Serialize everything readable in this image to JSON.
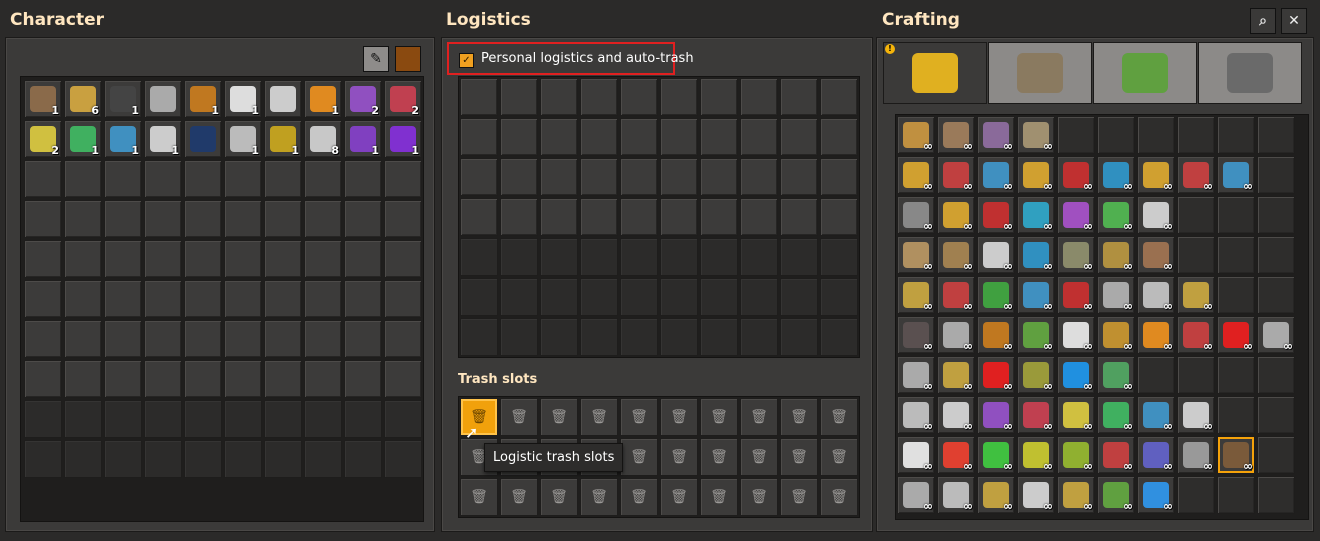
{
  "character": {
    "title": "Character",
    "main_inventory": [
      {
        "icon": "wooden-chest",
        "color": "#8a6a4a",
        "count": "1"
      },
      {
        "icon": "fast-splitter",
        "color": "#c9a040",
        "count": "6"
      },
      {
        "icon": "pistol",
        "color": "#444444",
        "count": "1"
      },
      {
        "icon": "submachine-gun",
        "color": "#aaaaaa",
        "count": ""
      },
      {
        "icon": "car",
        "color": "#c07820",
        "count": "1"
      },
      {
        "icon": "repair-pack",
        "color": "#dddddd",
        "count": "1"
      },
      {
        "icon": "car-white",
        "color": "#cccccc",
        "count": ""
      },
      {
        "icon": "spidertron",
        "color": "#e08a20",
        "count": "1"
      },
      {
        "icon": "purple-chest",
        "color": "#9050c0",
        "count": "2"
      },
      {
        "icon": "red-chest",
        "color": "#c04050",
        "count": "2"
      },
      {
        "icon": "yellow-chest",
        "color": "#d0c040",
        "count": "2"
      },
      {
        "icon": "green-chest",
        "color": "#40b060",
        "count": "1"
      },
      {
        "icon": "blue-chest",
        "color": "#4090c0",
        "count": "1"
      },
      {
        "icon": "roboport",
        "color": "#cccccc",
        "count": "1"
      },
      {
        "icon": "exoskeleton",
        "color": "#203a6a",
        "count": ""
      },
      {
        "icon": "gun",
        "color": "#bbbbbb",
        "count": "1"
      },
      {
        "icon": "fuel",
        "color": "#c0a020",
        "count": "1"
      },
      {
        "icon": "steel-plate",
        "color": "#c8c8c8",
        "count": "8"
      },
      {
        "icon": "module",
        "color": "#8040c0",
        "count": "1"
      },
      {
        "icon": "purple-module",
        "color": "#8030d0",
        "count": "1"
      }
    ],
    "rows": 10,
    "cols": 10
  },
  "logistics": {
    "title": "Logistics",
    "checkbox_label": "Personal logistics and auto-trash",
    "checkbox_checked": true,
    "trash_slots_title": "Trash slots",
    "tooltip": "Logistic trash slots"
  },
  "crafting": {
    "title": "Crafting",
    "tabs": [
      {
        "name": "logistics-tab",
        "color": "#e0b020"
      },
      {
        "name": "production-tab",
        "color": "#8a7a60"
      },
      {
        "name": "intermediate-tab",
        "color": "#60a040"
      },
      {
        "name": "combat-tab",
        "color": "#6a6a6a"
      }
    ],
    "rows": [
      [
        {
          "c": "#c09040"
        },
        {
          "c": "#9a7a5a"
        },
        {
          "c": "#8a6a9a"
        },
        {
          "c": "#a09070"
        }
      ],
      [
        {
          "c": "#d0a030"
        },
        {
          "c": "#c04040"
        },
        {
          "c": "#4090c0"
        },
        {
          "c": "#d0a030"
        },
        {
          "c": "#c03030"
        },
        {
          "c": "#3090c0"
        },
        {
          "c": "#d0a030"
        },
        {
          "c": "#c04040"
        },
        {
          "c": "#4090c0"
        }
      ],
      [
        {
          "c": "#888888"
        },
        {
          "c": "#d0a030"
        },
        {
          "c": "#c03030"
        },
        {
          "c": "#30a0c0"
        },
        {
          "c": "#a050c0"
        },
        {
          "c": "#50b050"
        },
        {
          "c": "#cccccc"
        }
      ],
      [
        {
          "c": "#b09060"
        },
        {
          "c": "#a08050"
        },
        {
          "c": "#cccccc"
        },
        {
          "c": "#3090c0"
        },
        {
          "c": "#8a8a6a"
        },
        {
          "c": "#b09040"
        },
        {
          "c": "#9a7050"
        }
      ],
      [
        {
          "c": "#c0a040"
        },
        {
          "c": "#c04040"
        },
        {
          "c": "#40a040"
        },
        {
          "c": "#4090c0"
        },
        {
          "c": "#c03030"
        },
        {
          "c": "#aaaaaa"
        },
        {
          "c": "#bbbbbb"
        },
        {
          "c": "#c0a040"
        }
      ],
      [
        {
          "c": "#5a5050"
        },
        {
          "c": "#aaaaaa"
        },
        {
          "c": "#c07820"
        },
        {
          "c": "#60a040"
        },
        {
          "c": "#dddddd"
        },
        {
          "c": "#c09030"
        },
        {
          "c": "#e08a20"
        },
        {
          "c": "#c04040"
        },
        {
          "c": "#e02020"
        },
        {
          "c": "#aaaaaa"
        }
      ],
      [
        {
          "c": "#aaaaaa"
        },
        {
          "c": "#c0a040"
        },
        {
          "c": "#e02020"
        },
        {
          "c": "#9a9a3a"
        },
        {
          "c": "#2090e0"
        },
        {
          "c": "#50a060"
        }
      ],
      [
        {
          "c": "#bbbbbb"
        },
        {
          "c": "#cccccc"
        },
        {
          "c": "#9050c0"
        },
        {
          "c": "#c04050"
        },
        {
          "c": "#d0c040"
        },
        {
          "c": "#40b060"
        },
        {
          "c": "#4090c0"
        },
        {
          "c": "#cccccc"
        }
      ],
      [
        {
          "c": "#e0e0e0"
        },
        {
          "c": "#e04030"
        },
        {
          "c": "#40c040"
        },
        {
          "c": "#c0c030"
        },
        {
          "c": "#90b030"
        },
        {
          "c": "#c04040"
        },
        {
          "c": "#6060c0"
        },
        {
          "c": "#999999"
        },
        {
          "c": "#7a5a3a"
        }
      ],
      [
        {
          "c": "#aaaaaa"
        },
        {
          "c": "#bbbbbb"
        },
        {
          "c": "#c0a040"
        },
        {
          "c": "#cccccc"
        },
        {
          "c": "#c0a040"
        },
        {
          "c": "#60a040"
        },
        {
          "c": "#3090e0"
        }
      ]
    ],
    "infinity": "∞"
  }
}
